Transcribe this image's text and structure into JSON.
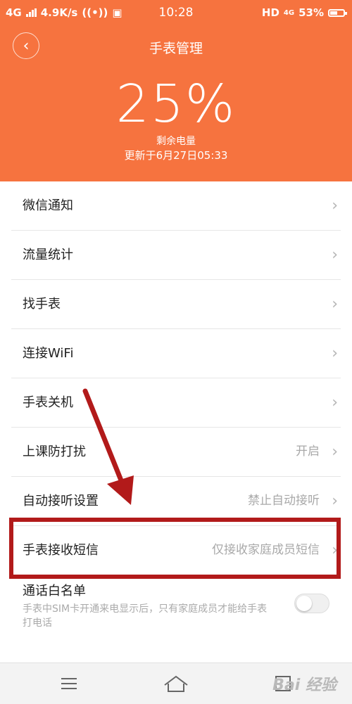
{
  "status_bar": {
    "network": "4G",
    "speed": "4.9K/s",
    "time": "10:28",
    "hd": "HD",
    "net_badge": "4G",
    "battery": "53%",
    "battery_level": 0.53
  },
  "header": {
    "title": "手表管理",
    "battery_percent": "25%",
    "battery_label": "剩余电量",
    "updated": "更新于6月27日05:33"
  },
  "menu": [
    {
      "label": "微信通知",
      "value": ""
    },
    {
      "label": "流量统计",
      "value": ""
    },
    {
      "label": "找手表",
      "value": ""
    },
    {
      "label": "连接WiFi",
      "value": ""
    },
    {
      "label": "手表关机",
      "value": ""
    },
    {
      "label": "上课防打扰",
      "value": "开启"
    },
    {
      "label": "自动接听设置",
      "value": "禁止自动接听"
    },
    {
      "label": "手表接收短信",
      "value": "仅接收家庭成员短信"
    }
  ],
  "whitelist": {
    "label": "通话白名单",
    "description": "手表中SIM卡开通来电显示后，只有家庭成员才能给手表打电话",
    "enabled": false
  },
  "watermark": "Bai 经验",
  "colors": {
    "header_bg": "#f6733f",
    "annotation": "#b21a1a"
  }
}
